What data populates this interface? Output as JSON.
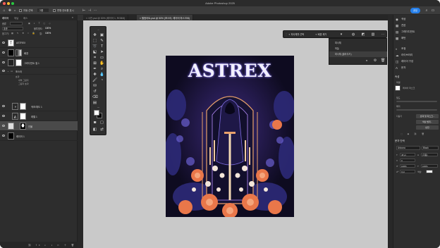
{
  "app": {
    "title": "Adobe Photoshop 2025"
  },
  "optbar": {
    "auto_select_label": "자동 선택:",
    "auto_select_value": "그룹",
    "show_transform_label": "변형 컨트롤 표시",
    "share_label": "공유"
  },
  "tabs": [
    {
      "label": "× 사진.psd @ 50% (레이어 1, RGB/8)"
    },
    {
      "label": "× 앨범아트.psd @ 50% (포스터, 레이어 마스크/8)"
    }
  ],
  "layers_panel": {
    "tabs": [
      "레이어",
      "채널",
      "패스"
    ],
    "kind_label": "종류",
    "blend_mode": "표준",
    "opacity_label": "불투명도:",
    "opacity_value": "100%",
    "lock_label": "잠그기:",
    "fill_label": "칠:",
    "fill_value": "100%",
    "layers": [
      {
        "name": "ASTREX"
      },
      {
        "name": "배경"
      },
      {
        "name": "그라디언트 칠 1"
      },
      {
        "name": "포스터"
      },
      {
        "name": "효과"
      },
      {
        "name": "내부 그림자"
      },
      {
        "name": "그림자 효과"
      },
      {
        "name": "색조/채도 1"
      },
      {
        "name": "레벨 1"
      },
      {
        "name": "인물"
      },
      {
        "name": "레이어 1"
      }
    ]
  },
  "artwork": {
    "title": "ASTREX"
  },
  "context_bar": {
    "select_subject": "피사체를 선택",
    "remove_background": "배경 제거"
  },
  "context_dropdown": {
    "items": [
      "피사체",
      "하늘",
      "피사체 (클라우드)"
    ]
  },
  "right_panel": {
    "items": [
      "색상",
      "견본",
      "그레이디언트",
      "패턴",
      "조정",
      "라이브러리",
      "레이어 구성",
      "문자"
    ],
    "properties_title": "속성",
    "pixel_label": "픽셀",
    "mask_label": "레이어 마스크",
    "density_label": "밀도",
    "feather_label": "페더",
    "refine_label": "다듬기",
    "select_mask_button": "선택 및 마스크...",
    "color_range_button": "색상 범위...",
    "invert_button": "반전",
    "char_title": "문자 단락",
    "font_family": "Arizona",
    "font_style": "Black",
    "font_size": "48 pt",
    "leading": "(자동)",
    "tracking": "0",
    "scale_v": "100%",
    "scale_h": "100%",
    "baseline": "0 pt",
    "color_label": "색상:"
  }
}
